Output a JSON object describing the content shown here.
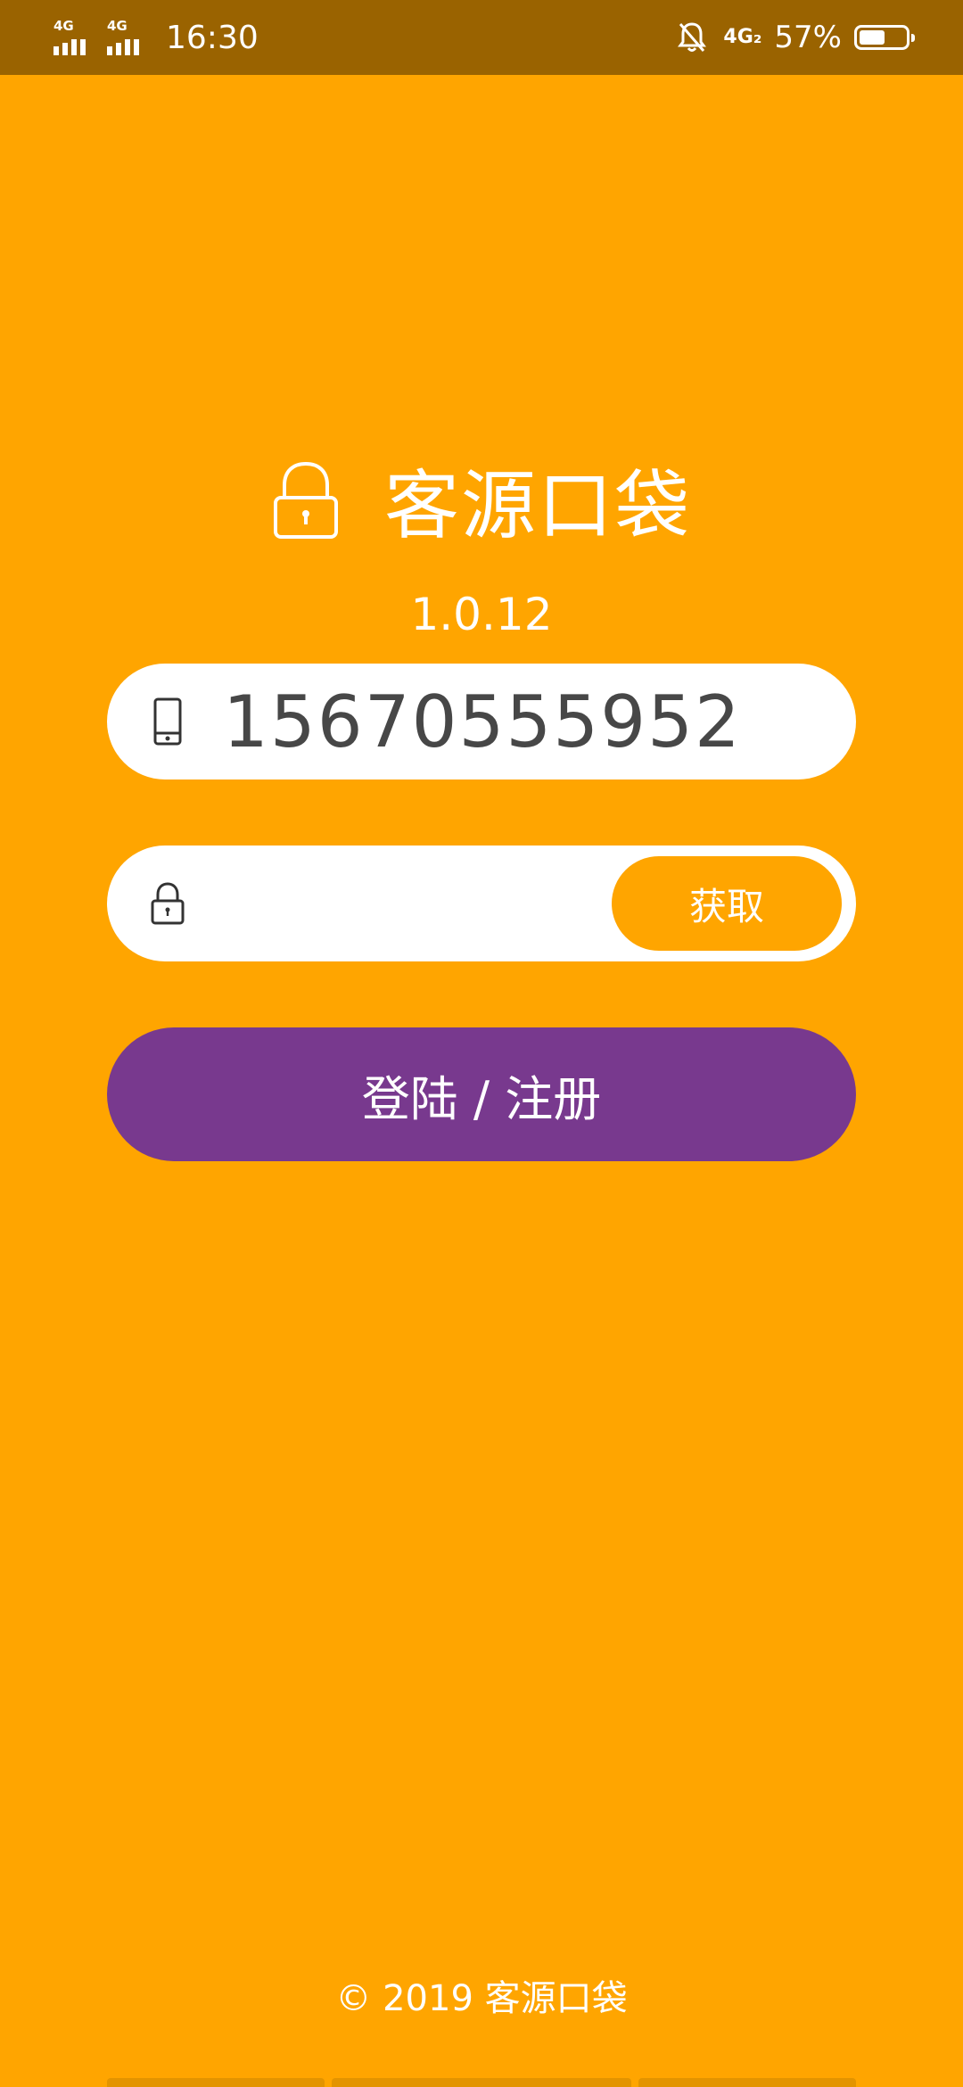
{
  "status_bar": {
    "sim1_tag": "4G",
    "sim2_tag": "4G",
    "time": "16:30",
    "network_tag": "4G₂",
    "battery_percent_text": "57%",
    "battery_level": 0.57,
    "mute_icon": "bell-off-icon"
  },
  "app": {
    "title": "客源口袋",
    "version": "1.0.12",
    "brand_icon": "lock-icon"
  },
  "phone_field": {
    "icon": "phone-icon",
    "value": "15670555952"
  },
  "code_field": {
    "icon": "lock-icon",
    "value": "",
    "get_button_label": "获取"
  },
  "login_button": {
    "label": "登陆 / 注册"
  },
  "footer": {
    "text": "© 2019 客源口袋"
  },
  "colors": {
    "background": "#FFA500",
    "status_bar": "#9A6300",
    "primary_button": "#78398E",
    "input_text": "#474747"
  }
}
